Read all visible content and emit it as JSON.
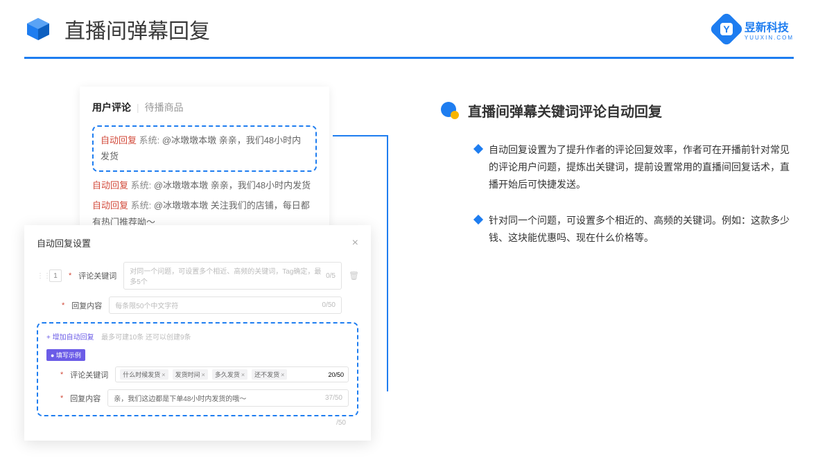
{
  "header": {
    "title": "直播间弹幕回复",
    "brand_name": "昱新科技",
    "brand_sub": "YUUXIN.COM",
    "brand_letter": "Y"
  },
  "comments": {
    "tab_active": "用户评论",
    "tab_inactive": "待播商品",
    "items": [
      {
        "prefix": "自动回复",
        "system": "系统:",
        "text": "@冰墩墩本墩 亲亲，我们48小时内发货"
      },
      {
        "prefix": "自动回复",
        "system": "系统:",
        "text": "@冰墩墩本墩 亲亲，我们48小时内发货"
      },
      {
        "prefix": "自动回复",
        "system": "系统:",
        "text": "@冰墩墩本墩 关注我们的店铺，每日都有热门推荐呦～"
      }
    ]
  },
  "modal": {
    "title": "自动回复设置",
    "row_number": "1",
    "keyword_label": "评论关键词",
    "keyword_placeholder": "对同一个问题，可设置多个相近、高频的关键词，Tag确定，最多5个",
    "keyword_count": "0/5",
    "content_label": "回复内容",
    "content_placeholder": "每条限50个中文字符",
    "content_count": "0/50",
    "add_text": "+ 增加自动回复",
    "add_hint": "最多可建10条 还可以创建9条",
    "badge": "● 填写示例",
    "ex_keyword_label": "评论关键词",
    "ex_tags": [
      "什么时候发货",
      "发货时间",
      "多久发货",
      "还不发货"
    ],
    "ex_keyword_count": "20/50",
    "ex_content_label": "回复内容",
    "ex_content_text": "亲，我们这边都是下单48小时内发货的哦～",
    "ex_content_count": "37/50",
    "outer_count": "/50"
  },
  "right": {
    "section_title": "直播间弹幕关键词评论自动回复",
    "bullets": [
      "自动回复设置为了提升作者的评论回复效率，作者可在开播前针对常见的评论用户问题，提炼出关键词，提前设置常用的直播间回复话术，直播开始后可快捷发送。",
      "针对同一个问题，可设置多个相近的、高频的关键词。例如：这款多少钱、这块能优惠吗、现在什么价格等。"
    ]
  }
}
